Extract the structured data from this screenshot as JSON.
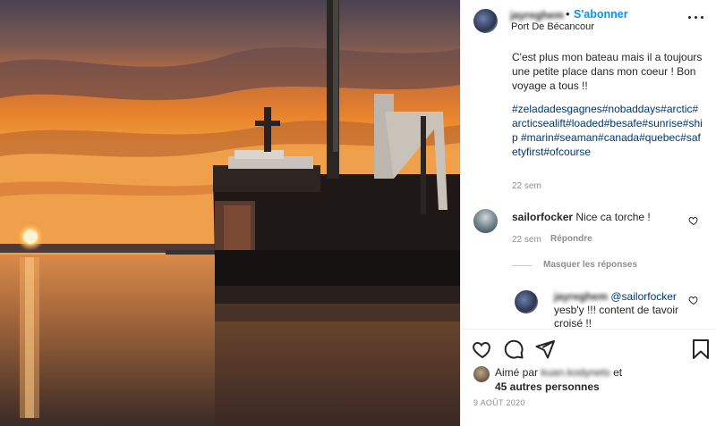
{
  "post": {
    "username": "jayreghem",
    "dot": "•",
    "follow_label": "S'abonner",
    "location": "Port De Bécancour",
    "caption": "C'est plus mon bateau mais il a toujours une petite place dans mon coeur ! Bon voyage a tous !!",
    "hashtags": "#zeladadesgagnes#nobaddays#arctic#arcticsealift#loaded#besafe#sunrise#ship #marin#seaman#canada#quebec#safetyfirst#ofcourse",
    "caption_time": "22 sem"
  },
  "comments": [
    {
      "user": "sailorfocker",
      "text": "Nice ca torche !",
      "time": "22 sem",
      "reply_label": "Répondre"
    }
  ],
  "hide_replies_label": "Masquer les réponses",
  "reply": {
    "user": "jayreghem",
    "mention": "@sailorfocker",
    "text": "yesb'y !!! content de tavoir croisé !!"
  },
  "likes": {
    "prefix": "Aimé par",
    "liker": "kuan.kodynets",
    "suffix": "et",
    "others": "45 autres personnes"
  },
  "date": "9 AOÛT 2020",
  "icons": [
    "more-icon",
    "heart-icon",
    "comment-icon",
    "share-icon",
    "bookmark-icon"
  ]
}
